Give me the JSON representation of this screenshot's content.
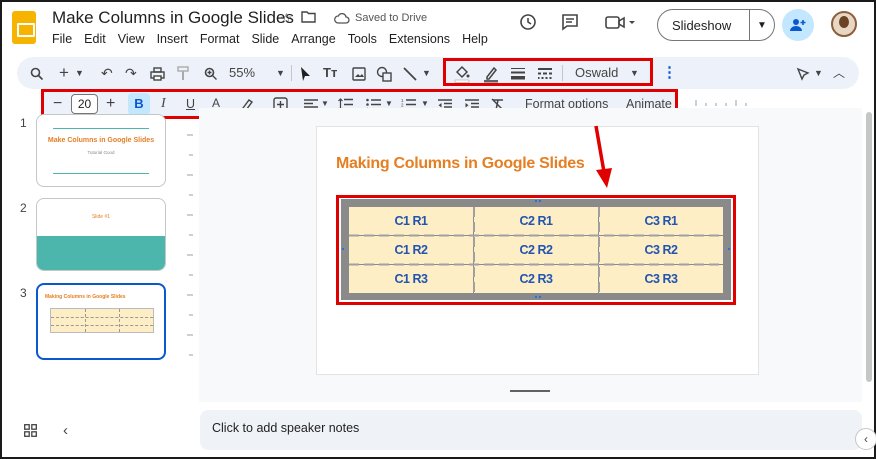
{
  "app": {
    "title": "Make Columns in Google Slides",
    "saved_status": "Saved to Drive",
    "menu": [
      "File",
      "Edit",
      "View",
      "Insert",
      "Format",
      "Slide",
      "Arrange",
      "Tools",
      "Extensions",
      "Help"
    ],
    "slideshow_label": "Slideshow"
  },
  "toolbar": {
    "zoom": "55%",
    "font": "Oswald"
  },
  "format_toolbar": {
    "font_size": "20",
    "format_options": "Format options",
    "animate": "Animate"
  },
  "thumbnails": [
    {
      "num": "1",
      "title": "Make Columns in Google Slides",
      "subtitle": "Tutorial Good"
    },
    {
      "num": "2",
      "title": "Slide #1"
    },
    {
      "num": "3",
      "title": "Making Columns in Google Slides"
    }
  ],
  "slide": {
    "title": "Making Columns in Google Slides",
    "table": [
      [
        "C1 R1",
        "C2 R1",
        "C3 R1"
      ],
      [
        "C1 R2",
        "C2 R2",
        "C3 R2"
      ],
      [
        "C1 R3",
        "C2 R3",
        "C3 R3"
      ]
    ]
  },
  "notes": {
    "placeholder": "Click to add speaker notes"
  },
  "colors": {
    "highlight": "#e00000",
    "slide_title": "#e67e22",
    "cell_fill": "#fdeec6",
    "cell_text": "#2155b0",
    "thumb2_band": "#4db6ac"
  }
}
